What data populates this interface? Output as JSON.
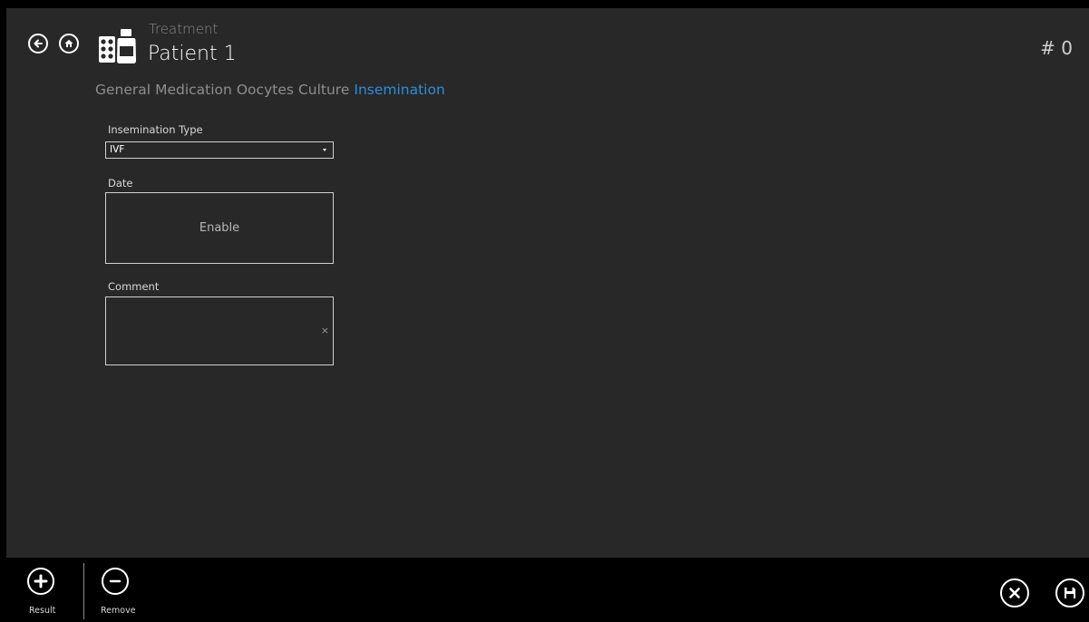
{
  "header": {
    "subtitle": "Treatment",
    "title": "Patient 1",
    "counter": "# 0",
    "back_icon": "back-arrow-icon",
    "home_icon": "home-icon",
    "app_icon": "medication-pills-bottle-icon"
  },
  "tabs": [
    {
      "label": "General",
      "active": false
    },
    {
      "label": "Medication",
      "active": false
    },
    {
      "label": "Oocytes",
      "active": false
    },
    {
      "label": "Culture",
      "active": false
    },
    {
      "label": "Insemination",
      "active": true
    }
  ],
  "form": {
    "insemination_type_label": "Insemination Type",
    "insemination_type_value": "IVF",
    "date_label": "Date",
    "date_button": "Enable",
    "comment_label": "Comment",
    "comment_value": "",
    "comment_clear": "×"
  },
  "bottom_bar": {
    "result_label": "Result",
    "remove_label": "Remove",
    "result_icon": "plus-circle-icon",
    "remove_icon": "minus-circle-icon",
    "cancel_icon": "close-circle-icon",
    "save_icon": "save-icon"
  },
  "colors": {
    "background": "#282828",
    "bar": "#000000",
    "accent": "#2c8fd9"
  }
}
